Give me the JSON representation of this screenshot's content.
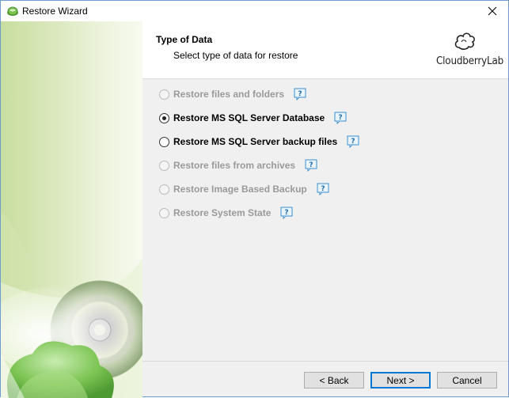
{
  "window": {
    "title": "Restore Wizard"
  },
  "header": {
    "title": "Type of Data",
    "subtitle": "Select type of data for restore",
    "logo_text": "CloudberryLab"
  },
  "options": [
    {
      "label": "Restore files and folders",
      "enabled": false,
      "selected": false
    },
    {
      "label": "Restore MS SQL Server Database",
      "enabled": true,
      "selected": true
    },
    {
      "label": "Restore MS SQL Server backup files",
      "enabled": true,
      "selected": false
    },
    {
      "label": "Restore files from archives",
      "enabled": false,
      "selected": false
    },
    {
      "label": "Restore Image Based Backup",
      "enabled": false,
      "selected": false
    },
    {
      "label": "Restore System State",
      "enabled": false,
      "selected": false
    }
  ],
  "buttons": {
    "back": "< Back",
    "next": "Next >",
    "cancel": "Cancel"
  },
  "colors": {
    "accent": "#0078d7",
    "help_icon": "#3d8fd1",
    "disabled_text": "#9a9a9a"
  },
  "icons": {
    "app": "cloud-disk-icon",
    "close": "close-icon",
    "help": "help-question-icon",
    "logo": "cloudberry-logo-icon"
  }
}
